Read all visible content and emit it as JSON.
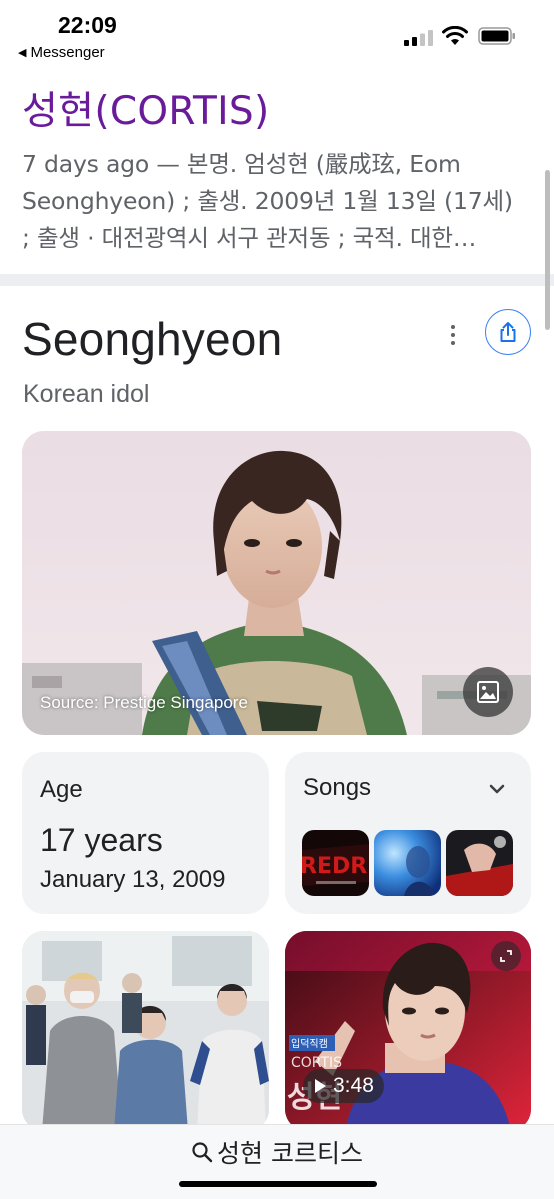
{
  "status_bar": {
    "time": "22:09",
    "back_app": "Messenger"
  },
  "result": {
    "title": "성현(CORTIS)",
    "snippet": "7 days ago — 본명. 엄성현 (嚴成玹, Eom Seonghyeon) ; 출생. 2009년 1월 13일 (17세) ; 출생 · 대전광역시 서구 관저동 ; 국적. 대한…"
  },
  "knowledge_panel": {
    "title": "Seonghyeon",
    "subtitle": "Korean idol",
    "image_credit": "Source: Prestige Singapore",
    "age": {
      "label": "Age",
      "value": "17 years",
      "birthdate": "January 13, 2009"
    },
    "songs": {
      "label": "Songs",
      "thumbnails": [
        "album-art-redred",
        "album-art-blue",
        "album-art-red-hand"
      ]
    },
    "video": {
      "duration": "3:48"
    }
  },
  "search_bar": {
    "query": "성현 코르티스"
  },
  "icons": {
    "more": "more-vert-icon",
    "share": "share-icon",
    "image": "image-icon",
    "chevron": "chevron-down-icon",
    "play": "play-icon",
    "expand": "expand-icon",
    "search": "search-icon"
  },
  "colors": {
    "title_purple": "#6a1b9a",
    "accent_blue": "#4285f4",
    "card_bg": "#f1f3f4"
  }
}
